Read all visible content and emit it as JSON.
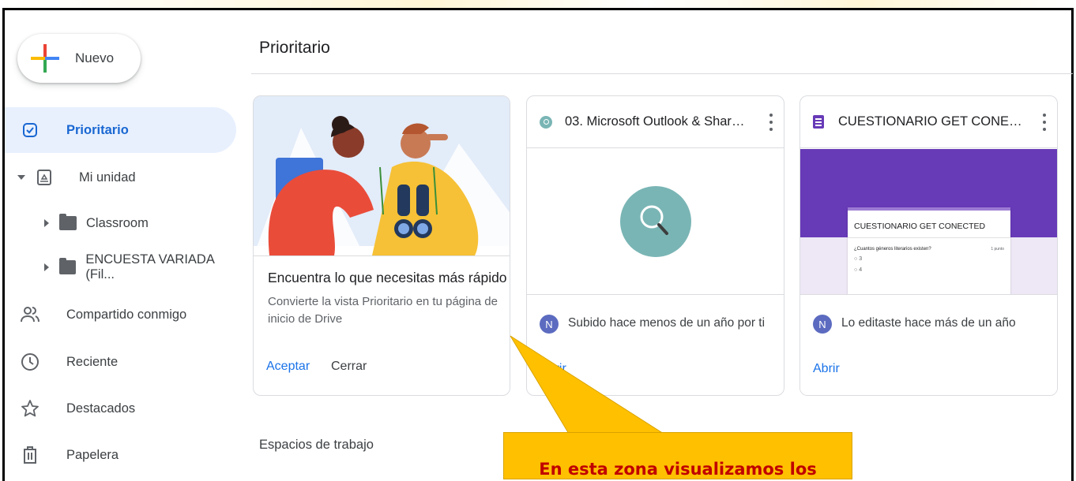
{
  "sidebar": {
    "new_label": "Nuevo",
    "items": [
      {
        "label": "Prioritario",
        "icon": "priority-check-icon",
        "active": true
      },
      {
        "label": "Mi unidad",
        "icon": "drive-icon"
      },
      {
        "label": "Classroom",
        "icon": "folder-icon"
      },
      {
        "label": "ENCUESTA VARIADA (Fil...",
        "icon": "folder-icon"
      },
      {
        "label": "Compartido conmigo",
        "icon": "people-icon"
      },
      {
        "label": "Reciente",
        "icon": "clock-icon"
      },
      {
        "label": "Destacados",
        "icon": "star-icon"
      },
      {
        "label": "Papelera",
        "icon": "trash-icon"
      }
    ]
  },
  "main": {
    "title": "Prioritario",
    "promo": {
      "heading": "Encuentra lo que necesitas más rápido",
      "body": "Convierte la vista Prioritario en tu página de inicio de Drive",
      "accept": "Aceptar",
      "close": "Cerrar"
    },
    "cards": [
      {
        "title": "03. Microsoft Outlook & ShareP...",
        "icon": "search-doc-icon",
        "avatar": "N",
        "activity": "Subido hace menos de un año por ti",
        "open": "Abrir"
      },
      {
        "title": "CUESTIONARIO GET CONECTED",
        "icon": "forms-icon",
        "avatar": "N",
        "activity": "Lo editaste hace más de un año",
        "open": "Abrir",
        "preview": {
          "title": "CUESTIONARIO GET CONECTED",
          "question": "¿Cuantos géneros literarios existen?",
          "points": "1 punto",
          "options": [
            "3",
            "4"
          ]
        }
      }
    ],
    "workspaces": "Espacios de trabajo"
  },
  "callout": {
    "text": "En esta zona visualizamos los"
  },
  "colors": {
    "accent": "#1a73e8",
    "active_bg": "#e8f0fe",
    "forms_purple": "#673ab7",
    "callout_bg": "#ffc000",
    "callout_text": "#c00000"
  }
}
